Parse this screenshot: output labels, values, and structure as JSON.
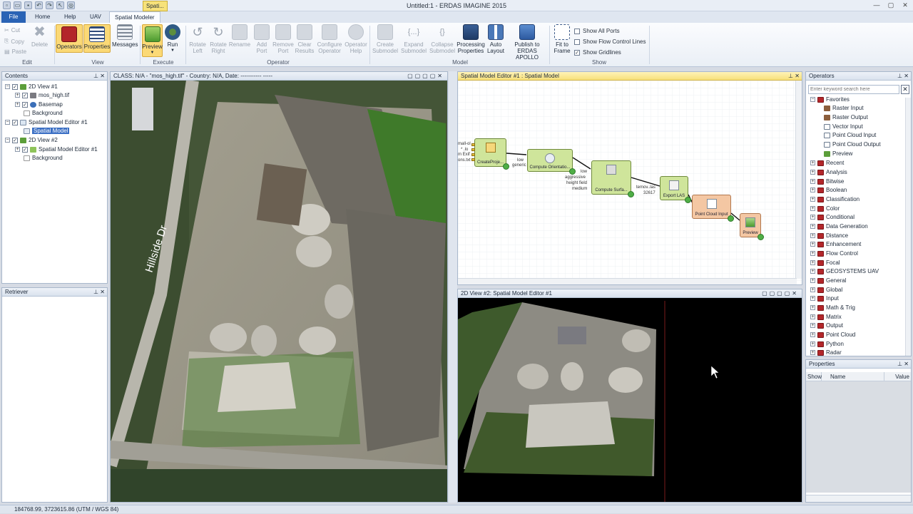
{
  "app": {
    "title": "Untitled:1 - ERDAS IMAGINE 2015",
    "context_tab": "Spati..."
  },
  "tabs": [
    "File",
    "Home",
    "Help",
    "UAV",
    "Spatial Modeler"
  ],
  "ribbon": {
    "edit": {
      "group": "Edit",
      "delete": "Delete",
      "cut": "Cut",
      "copy": "Copy",
      "paste": "Paste"
    },
    "view": {
      "group": "View",
      "operators": "Operators",
      "properties": "Properties",
      "messages": "Messages"
    },
    "execute": {
      "group": "Execute",
      "preview": "Preview",
      "run": "Run"
    },
    "operator": {
      "group": "Operator",
      "rotate_left": "Rotate Left",
      "rotate_right": "Rotate Right",
      "rename": "Rename",
      "add_port": "Add Port",
      "remove_port": "Remove Port",
      "clear_results": "Clear Results",
      "configure_operator": "Configure Operator",
      "operator_help": "Operator Help"
    },
    "model": {
      "group": "Model",
      "create_submodel": "Create Submodel",
      "expand_submodel": "Expand Submodel",
      "collapse_submodel": "Collapse Submodel",
      "processing_properties": "Processing Properties",
      "auto_layout": "Auto Layout",
      "publish": "Publish to ERDAS APOLLO"
    },
    "show": {
      "group": "Show",
      "fit_to_frame": "Fit to Frame",
      "show_all_ports": "Show All Ports",
      "show_flow_control_lines": "Show Flow Control Lines",
      "show_gridlines": "Show Gridlines",
      "gridlines_checked": true
    }
  },
  "contents": {
    "title": "Contents",
    "items": [
      "2D View #1",
      "mos_high.tif",
      "Basemap",
      "Background",
      "Spatial Model Editor #1",
      "Spatial Model",
      "2D View #2",
      "Spatial Model Editor #1",
      "Background"
    ]
  },
  "retriever": {
    "title": "Retriever"
  },
  "view1": {
    "header": "CLASS: N/A - \"mos_high.tif\" - Country: N/A, Date: ----------- -----",
    "road_label": "Hillside Dr"
  },
  "sme": {
    "header": "Spatial Model Editor #1 : Spatial Model",
    "nodes": {
      "create_project": "CreateProje...",
      "compute_orientation": "Compute Orientatio...",
      "compute_surface": "Compute Surfa...",
      "export_las": "Export LAS",
      "point_cloud_input": "Point Cloud Input",
      "preview": "Preview"
    },
    "ports": {
      "p1": "mall-ol",
      "p2": "* .lo",
      "p3": "m Exif",
      "p4": "ons.txt",
      "low": "low",
      "generic": "generic",
      "low2": "low",
      "aggressive": "aggressive",
      "height_field": "height field",
      "medium": "medium",
      "temp_las": "temov..las",
      "num": "32617"
    }
  },
  "view2": {
    "header": "2D View #2: Spatial Model Editor #1"
  },
  "operators": {
    "title": "Operators",
    "search_placeholder": "Enter keyword search here",
    "favorites_label": "Favorites",
    "favorites": [
      "Raster Input",
      "Raster Output",
      "Vector Input",
      "Point Cloud Input",
      "Point Cloud Output",
      "Preview"
    ],
    "categories": [
      "Recent",
      "Analysis",
      "Bitwise",
      "Boolean",
      "Classification",
      "Color",
      "Conditional",
      "Data Generation",
      "Distance",
      "Enhancement",
      "Flow Control",
      "Focal",
      "GEOSYSTEMS UAV",
      "General",
      "Global",
      "Input",
      "Math & Trig",
      "Matrix",
      "Output",
      "Point Cloud",
      "Python",
      "Radar"
    ]
  },
  "properties": {
    "title": "Properties",
    "columns": [
      "Show",
      "Name",
      "Value"
    ]
  },
  "status": {
    "coords": "184768.99, 3723615.86  (UTM / WGS 84)"
  }
}
